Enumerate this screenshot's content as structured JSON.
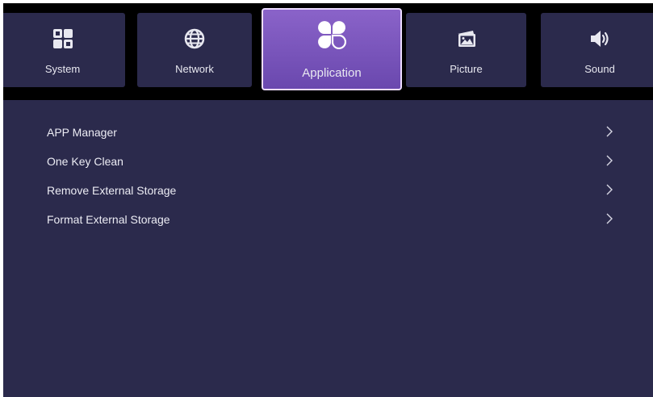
{
  "tabs": [
    {
      "label": "System",
      "icon": "system-grid-icon"
    },
    {
      "label": "Network",
      "icon": "globe-icon"
    },
    {
      "label": "Application",
      "icon": "clover-apps-icon"
    },
    {
      "label": "Picture",
      "icon": "picture-icon"
    },
    {
      "label": "Sound",
      "icon": "speaker-icon"
    }
  ],
  "active_tab": "Application",
  "menu": {
    "items": [
      {
        "label": "APP Manager"
      },
      {
        "label": "One Key Clean"
      },
      {
        "label": "Remove External Storage"
      },
      {
        "label": "Format External Storage"
      }
    ]
  },
  "colors": {
    "background": "#2b2a4c",
    "tabbar": "#000000",
    "active_tab": "#7a55bd",
    "active_border": "#ecdcff",
    "text": "#ececf4"
  }
}
